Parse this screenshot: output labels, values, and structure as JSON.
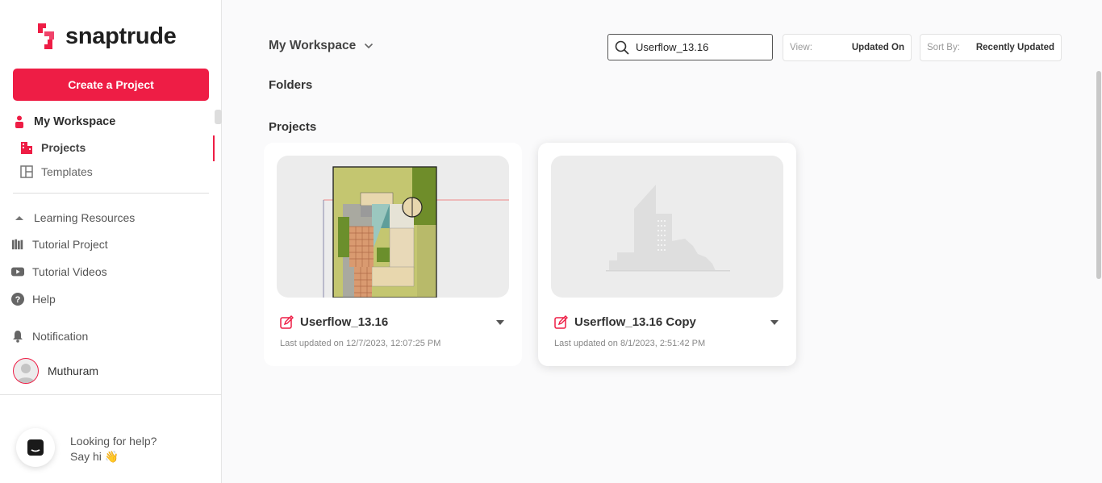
{
  "brand": {
    "name": "snaptrude",
    "accent": "#ee1d45"
  },
  "sidebar": {
    "create_label": "Create a Project",
    "workspace_label": "My Workspace",
    "projects_label": "Projects",
    "templates_label": "Templates",
    "learning_label": "Learning Resources",
    "tutorial_project_label": "Tutorial Project",
    "tutorial_videos_label": "Tutorial Videos",
    "help_label": "Help",
    "notification_label": "Notification",
    "user_name": "Muthuram",
    "chat_line1": "Looking for help?",
    "chat_line2": "Say hi 👋"
  },
  "header": {
    "workspace_title": "My Workspace",
    "search_value": "Userflow_13.16",
    "view_label": "View:",
    "view_value": "Updated On",
    "sort_label": "Sort By:",
    "sort_value": "Recently Updated"
  },
  "main": {
    "folders_heading": "Folders",
    "projects_heading": "Projects",
    "projects": [
      {
        "name": "Userflow_13.16",
        "updated": "Last updated on 12/7/2023, 12:07:25 PM"
      },
      {
        "name": "Userflow_13.16 Copy",
        "updated": "Last updated on 8/1/2023, 2:51:42 PM"
      }
    ]
  }
}
